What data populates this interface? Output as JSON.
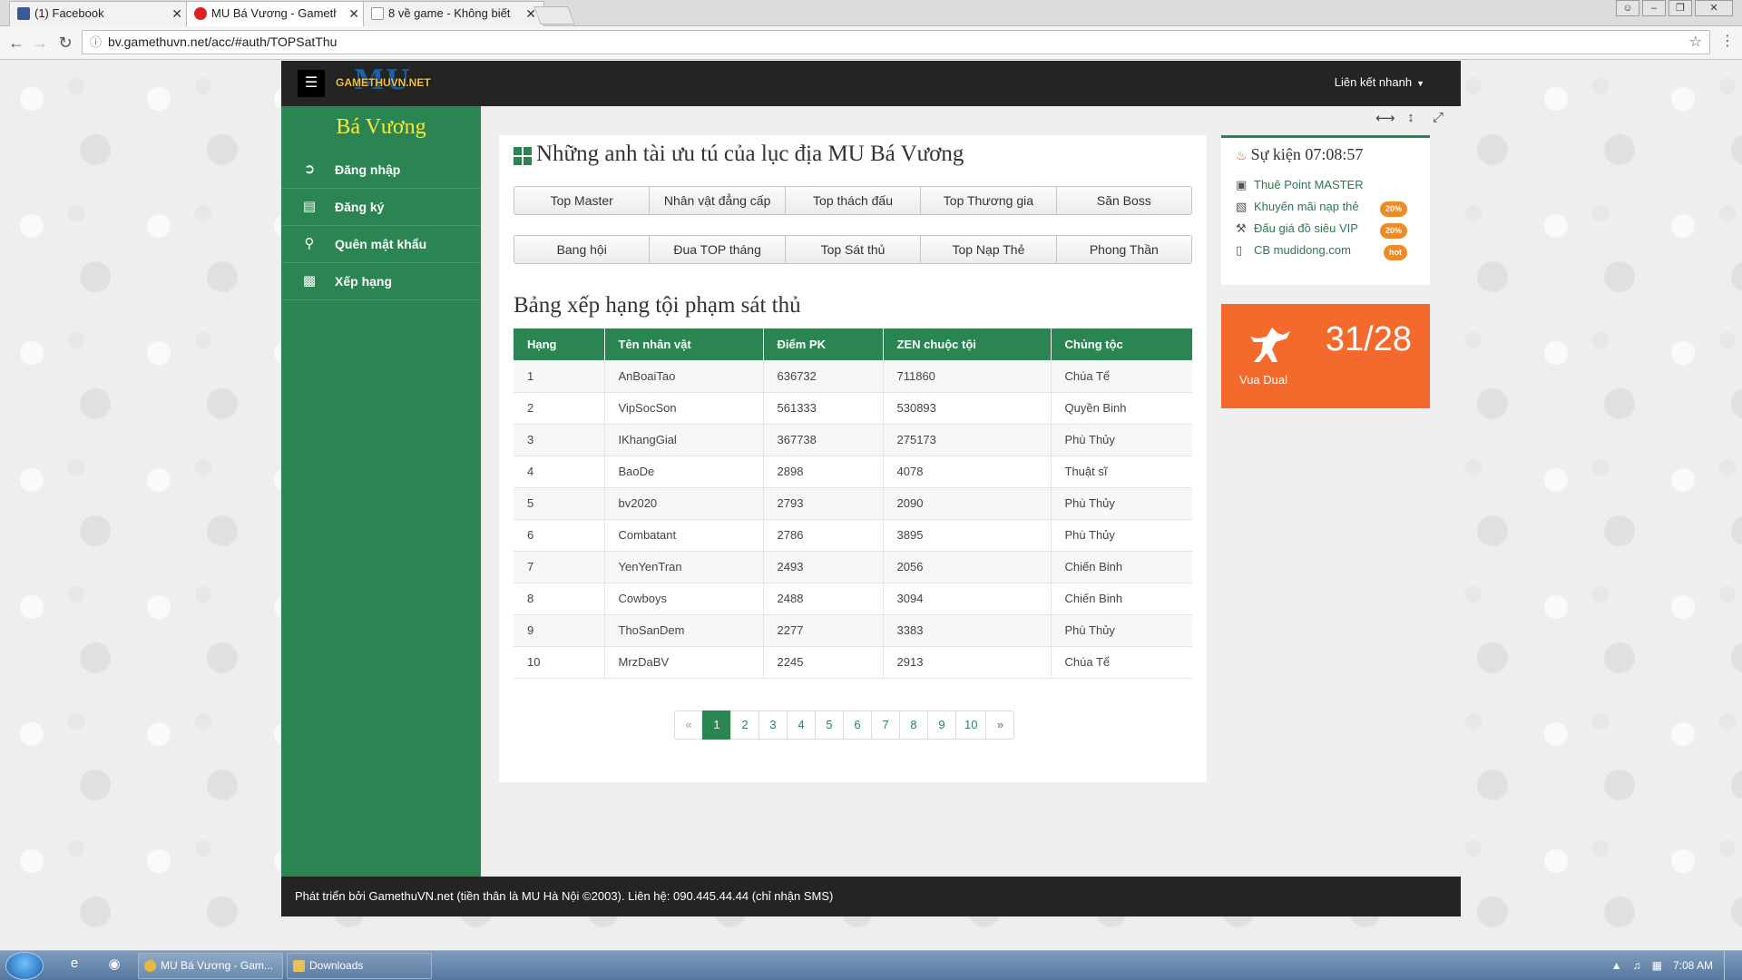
{
  "browser": {
    "tabs": [
      {
        "title": "(1) Facebook",
        "close": "✕"
      },
      {
        "title": "MU Bá Vương - Gamethu",
        "close": "✕"
      },
      {
        "title": "8 về game - Không biết",
        "close": "✕"
      }
    ],
    "url": "bv.gamethuvn.net/acc/#auth/TOPSatThu"
  },
  "site": {
    "logo_mu": "MU",
    "logo_text": "GAMETHUVN.NET",
    "quick_link": "Liên kết nhanh",
    "sidebar": {
      "title": "Bá Vương",
      "items": [
        {
          "label": "Đăng nhập",
          "icon": "sign-in-icon"
        },
        {
          "label": "Đăng ký",
          "icon": "file-icon"
        },
        {
          "label": "Quên mật khẩu",
          "icon": "key-icon"
        },
        {
          "label": "Xếp hạng",
          "icon": "bar-chart-icon"
        }
      ]
    },
    "main": {
      "title": "Những anh tài ưu tú của lục địa MU Bá Vương",
      "buttons_row1": [
        "Top Master",
        "Nhân vật đẳng cấp",
        "Top thách đấu",
        "Top Thương gia",
        "Săn Boss"
      ],
      "buttons_row2": [
        "Bang hội",
        "Đua TOP tháng",
        "Top Sát thủ",
        "Top Nạp Thẻ",
        "Phong Thần"
      ],
      "section_title": "Bảng xếp hạng tội phạm sát thủ",
      "table": {
        "headers": [
          "Hạng",
          "Tên nhân vật",
          "Điểm PK",
          "ZEN chuộc tội",
          "Chủng tộc"
        ],
        "rows": [
          [
            "1",
            "AnBoaiTao",
            "636732",
            "711860",
            "Chúa Tể"
          ],
          [
            "2",
            "VipSocSon",
            "561333",
            "530893",
            "Quyền Binh"
          ],
          [
            "3",
            "IKhangGial",
            "367738",
            "275173",
            "Phù Thủy"
          ],
          [
            "4",
            "BaoDe",
            "2898",
            "4078",
            "Thuật sĩ"
          ],
          [
            "5",
            "bv2020",
            "2793",
            "2090",
            "Phù Thủy"
          ],
          [
            "6",
            "Combatant",
            "2786",
            "3895",
            "Phù Thủy"
          ],
          [
            "7",
            "YenYenTran",
            "2493",
            "2056",
            "Chiến Binh"
          ],
          [
            "8",
            "Cowboys",
            "2488",
            "3094",
            "Chiến Binh"
          ],
          [
            "9",
            "ThoSanDem",
            "2277",
            "3383",
            "Phù Thủy"
          ],
          [
            "10",
            "MrzDaBV",
            "2245",
            "2913",
            "Chúa Tể"
          ]
        ]
      },
      "pagination": [
        "«",
        "1",
        "2",
        "3",
        "4",
        "5",
        "6",
        "7",
        "8",
        "9",
        "10",
        "»"
      ],
      "active_page": "1"
    },
    "events": {
      "title": "Sự kiện 07:08:57",
      "items": [
        {
          "label": "Thuê Point MASTER",
          "badge": ""
        },
        {
          "label": "Khuyến mãi nạp thẻ",
          "badge": "20%"
        },
        {
          "label": "Đấu giá đồ siêu VIP",
          "badge": "20%"
        },
        {
          "label": "CB mudidong.com",
          "badge": "hot"
        }
      ]
    },
    "duel": {
      "value": "31/28",
      "label": "Vua Dual"
    },
    "footer": "Phát triển bởi GamethuVN.net (tiền thân là MU Hà Nội ©2003). Liên hệ: 090.445.44.44 (chỉ nhận SMS)"
  },
  "taskbar": {
    "tasks": [
      "MU Bá Vương - Gam...",
      "Downloads"
    ],
    "time": "7:08 AM"
  },
  "colors": {
    "brand_green": "#2b8552",
    "header_dark": "#242424",
    "duel_orange": "#f36a2c",
    "badge_orange": "#ef8b22"
  }
}
